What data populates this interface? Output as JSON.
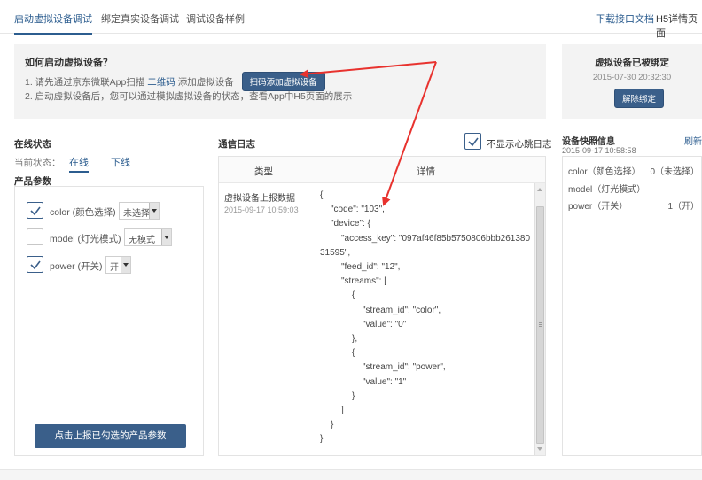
{
  "tabs": [
    {
      "label": "启动虚拟设备调试"
    },
    {
      "label": "绑定真实设备调试"
    },
    {
      "label": "调试设备样例"
    }
  ],
  "top_links": {
    "download": "下载接口文档",
    "h5": "H5详情页面"
  },
  "guide": {
    "title": "如何启动虚拟设备？",
    "step1_prefix": "1. 请先通过京东微联App扫描",
    "step1_link": "二维码",
    "step1_suffix": "添加虚拟设备",
    "scan_button": "扫码添加虚拟设备",
    "step2": "2. 启动虚拟设备后，您可以通过模拟虚拟设备的状态，查看App中H5页面的展示"
  },
  "binding": {
    "title": "虚拟设备已被绑定",
    "time": "2015-07-30 20:32:30",
    "unbind_button": "解除绑定"
  },
  "online": {
    "title": "在线状态",
    "current_label": "当前状态：",
    "online_label": "在线",
    "offline_label": "下线"
  },
  "product_params": {
    "title": "产品参数",
    "items": [
      {
        "label": "color (颜色选择)",
        "value": "未选择",
        "checked": true
      },
      {
        "label": "model (灯光模式)",
        "value": "无模式",
        "checked": false
      },
      {
        "label": "power (开关)",
        "value": "开",
        "checked": true
      }
    ],
    "report_button": "点击上报已勾选的产品参数"
  },
  "log": {
    "title": "通信日志",
    "hide_heartbeat_label": "不显示心跳日志",
    "hide_heartbeat_checked": true,
    "col_type": "类型",
    "col_detail": "详情",
    "entry_type": "虚拟设备上报数据",
    "entry_time": "2015-09-17 10:59:03",
    "json_lines": [
      "{",
      "\"code\": \"103\",",
      "\"device\": {",
      "\"access_key\": \"097af46f85b5750806bbb261380",
      "31595\",",
      "\"feed_id\": \"12\",",
      "\"streams\": [",
      "{",
      "\"stream_id\": \"color\",",
      "\"value\": \"0\"",
      "},",
      "{",
      "\"stream_id\": \"power\",",
      "\"value\": \"1\"",
      "}",
      "]",
      "}",
      "}"
    ]
  },
  "snapshot": {
    "title": "设备快照信息",
    "time": "2015-09-17 10:58:58",
    "refresh": "刷新",
    "rows": [
      {
        "key": "color（颜色选择）",
        "value": "0（未选择）"
      },
      {
        "key": "model（灯光模式）",
        "value": ""
      },
      {
        "key": "power（开关）",
        "value": "1（开）"
      }
    ]
  },
  "colors": {
    "accent": "#2c5d8f",
    "button": "#3a5f8a",
    "annotation_arrow": "#e8322e"
  }
}
